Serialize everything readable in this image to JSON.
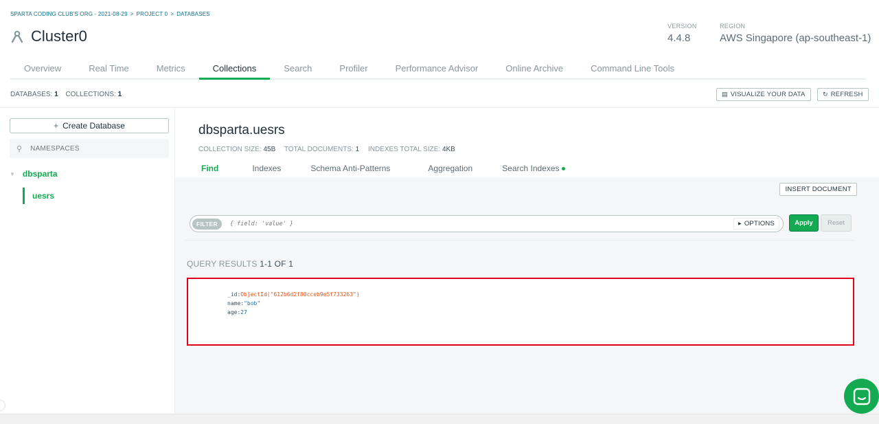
{
  "breadcrumb": [
    "SPARTA CODING CLUB'S ORG - 2021-08-29",
    ">",
    "PROJECT 0",
    ">",
    "DATABASES"
  ],
  "cluster": {
    "name": "Cluster0",
    "icon": "cluster-icon"
  },
  "meta": {
    "version_label": "VERSION",
    "version_value": "4.4.8",
    "region_label": "REGION",
    "region_value": "AWS Singapore (ap-southeast-1)"
  },
  "tabs": [
    "Overview",
    "Real Time",
    "Metrics",
    "Collections",
    "Search",
    "Profiler",
    "Performance Advisor",
    "Online Archive",
    "Command Line Tools"
  ],
  "active_tab": "Collections",
  "summary": {
    "databases_label": "DATABASES:",
    "databases_count": "1",
    "collections_label": "COLLECTIONS:",
    "collections_count": "1"
  },
  "toolbar": {
    "visualize_label": "VISUALIZE YOUR DATA",
    "refresh_label": "REFRESH"
  },
  "sidebar": {
    "create_db_label": "Create Database",
    "search_placeholder": "NAMESPACES",
    "database": "dbsparta",
    "collection": "uesrs"
  },
  "collection": {
    "title": "dbsparta.uesrs",
    "size_label": "COLLECTION SIZE:",
    "size_value": "45B",
    "docs_label": "TOTAL DOCUMENTS:",
    "docs_value": "1",
    "index_label": "INDEXES TOTAL SIZE:",
    "index_value": "4KB"
  },
  "subtabs": [
    "Find",
    "Indexes",
    "Schema Anti-Patterns",
    "Aggregation",
    "Search Indexes"
  ],
  "active_subtab": "Find",
  "find": {
    "insert_label": "INSERT DOCUMENT",
    "filter_chip": "FILTER",
    "filter_placeholder": "{ field: 'value' }",
    "options_label": "OPTIONS",
    "apply_label": "Apply",
    "reset_label": "Reset"
  },
  "results": {
    "label": "QUERY RESULTS",
    "range": "1-1 OF 1",
    "document": {
      "id_key": "_id:",
      "id_value": "ObjectId(\"612b6d2f80cceb9e5f733263\")",
      "name_key": "name:",
      "name_value": "\"bob\"",
      "age_key": "age:",
      "age_value": "27"
    }
  },
  "colors": {
    "accent": "#13aa52",
    "highlight_border": "#e3001b"
  }
}
